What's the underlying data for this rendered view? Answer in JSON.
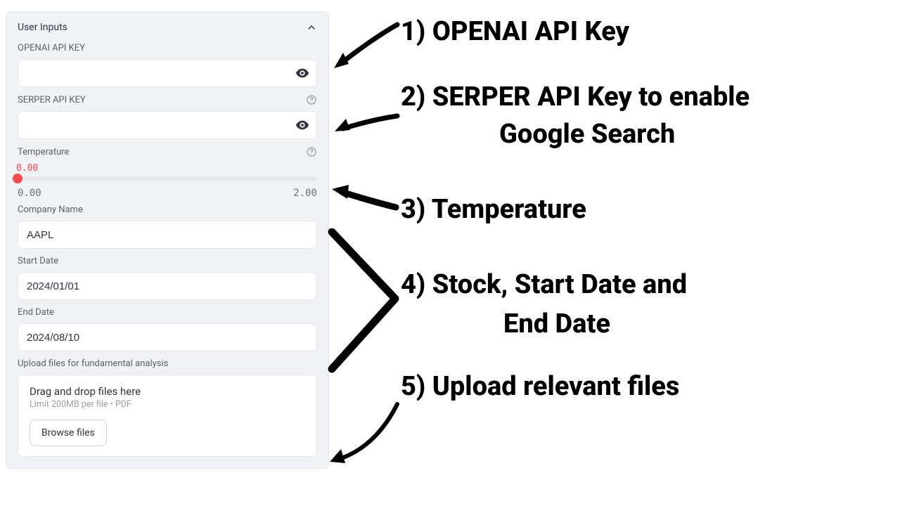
{
  "sidebar": {
    "header": "User Inputs",
    "openai": {
      "label": "OPENAI API KEY",
      "value": ""
    },
    "serper": {
      "label": "SERPER API KEY",
      "value": ""
    },
    "temperature": {
      "label": "Temperature",
      "value": "0.00",
      "min": "0.00",
      "max": "2.00"
    },
    "company": {
      "label": "Company Name",
      "value": "AAPL"
    },
    "start_date": {
      "label": "Start Date",
      "value": "2024/01/01"
    },
    "end_date": {
      "label": "End Date",
      "value": "2024/08/10"
    },
    "upload": {
      "label": "Upload files for fundamental analysis",
      "drop_text": "Drag and drop files here",
      "limit_text": "Limit 200MB per file • PDF",
      "browse_label": "Browse files"
    }
  },
  "annotations": {
    "a1": "1) OPENAI API Key",
    "a2_line1": "2) SERPER API Key to enable",
    "a2_line2": "Google Search",
    "a3": "3) Temperature",
    "a4_line1": "4) Stock, Start Date and",
    "a4_line2": "End Date",
    "a5": "5) Upload relevant files"
  }
}
